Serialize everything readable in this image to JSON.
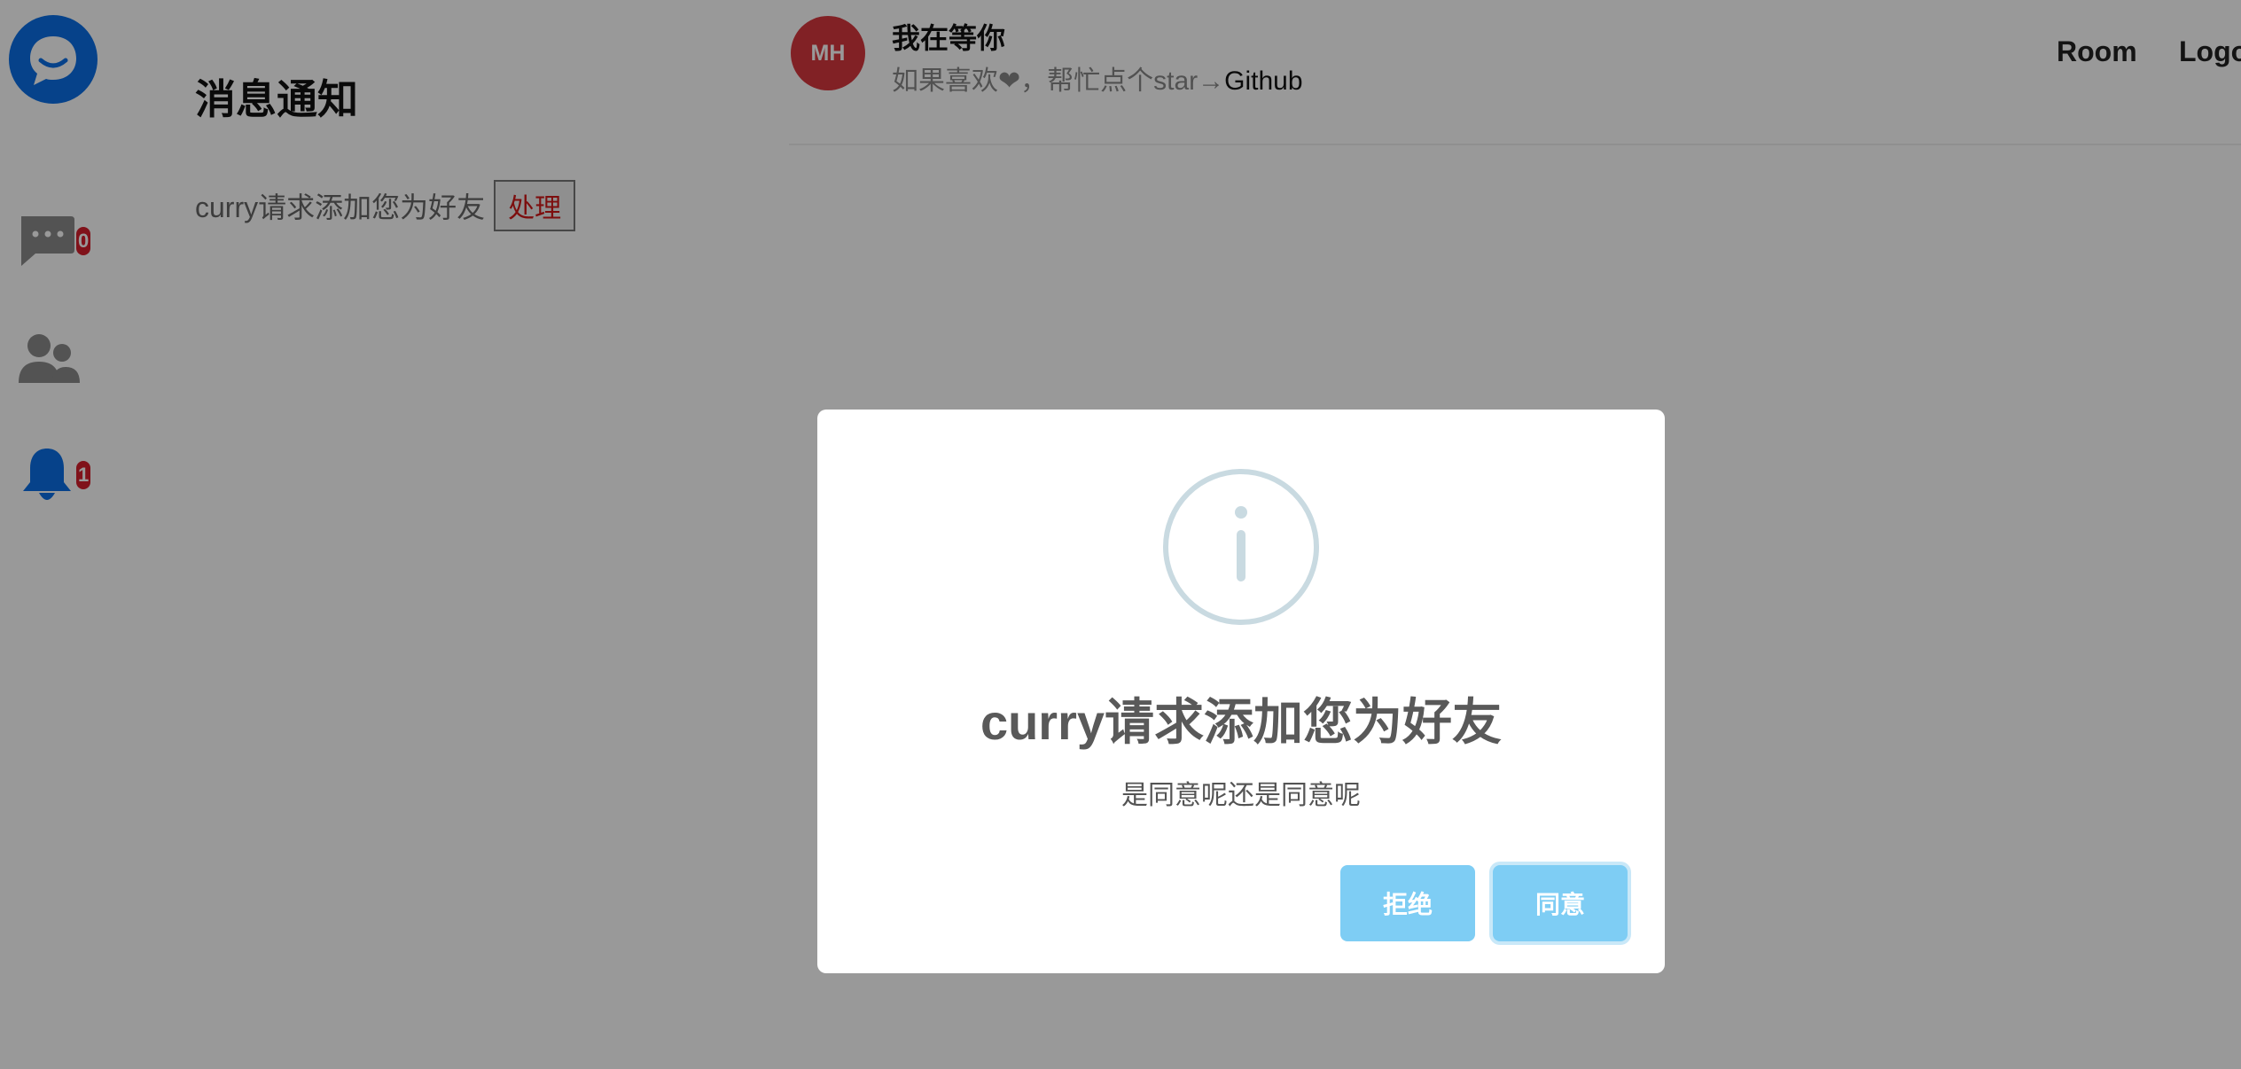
{
  "sidebar": {
    "logo_icon": "chat-bubble-smile-icon",
    "items": [
      {
        "icon": "message-dots-icon",
        "badge": "0"
      },
      {
        "icon": "users-icon",
        "badge": null
      },
      {
        "icon": "bell-icon",
        "badge": "1"
      }
    ]
  },
  "main": {
    "title": "消息通知",
    "notification": {
      "text": "curry请求添加您为好友",
      "action": "处理"
    }
  },
  "header": {
    "avatar_initials": "MH",
    "user_name": "我在等你",
    "subtitle_prefix": "如果喜欢❤，帮忙点个star→",
    "subtitle_link": "Github",
    "links": [
      "Room",
      "Logo"
    ]
  },
  "dialog": {
    "icon": "info-icon",
    "title": "curry请求添加您为好友",
    "text": "是同意呢还是同意呢",
    "reject_label": "拒绝",
    "accept_label": "同意"
  },
  "colors": {
    "brand_blue": "#0a6fe6",
    "badge_red": "#d61f2c",
    "avatar_red": "#d8373f",
    "button_blue": "#7ecdf4",
    "info_ring": "#c9dae1"
  }
}
